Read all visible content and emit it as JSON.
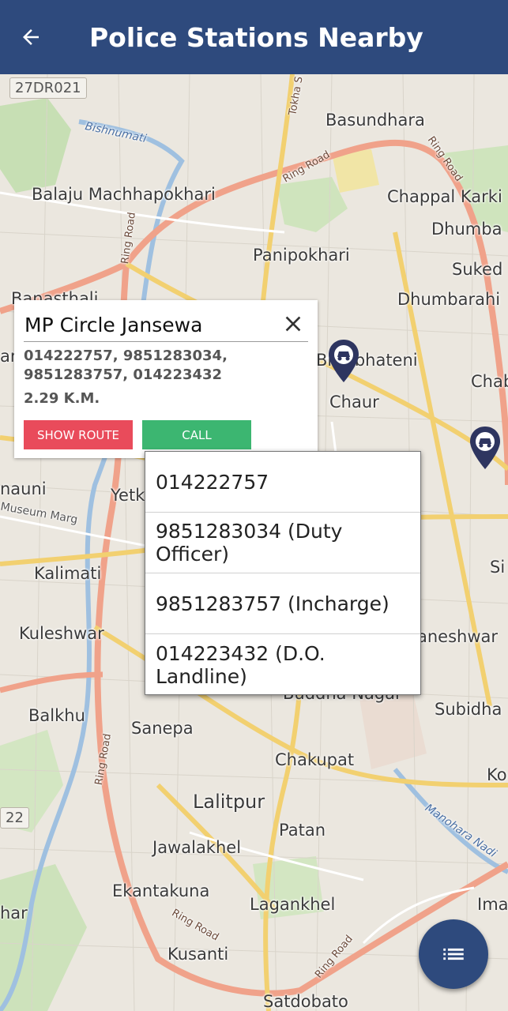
{
  "header": {
    "title": "Police Stations Nearby",
    "back_icon": "arrow-left-icon"
  },
  "map": {
    "labels": {
      "road_code": "27DR021",
      "road_code_2": "22",
      "basundhara": "Basundhara",
      "bishnumati": "Bishnumati",
      "tokha": "Tokha S",
      "balaju": "Balaju Machhapokhari",
      "chappal": "Chappal Karki",
      "dhumba": "Dhumba",
      "panipokhari": "Panipokhari",
      "suked": "Suked",
      "dhumbarahi": "Dhumbarahi",
      "banasthali": "Banasthali",
      "bhagwati": "Bhatbhateni",
      "chaur": "Chaur",
      "chab": "Chab",
      "nauni": "nauni",
      "yetk": "Yetk",
      "museum": "Museum Marg",
      "kalimati": "Kalimati",
      "kuleshwar": "Kuleshwar",
      "aneshwar": "aneshwar",
      "si": "Si",
      "balkhu": "Balkhu",
      "sanepa": "Sanepa",
      "buddha": "Buddha Nagar",
      "subidha": "Subidha",
      "chakupat": "Chakupat",
      "ko": "Ko",
      "lalitpur": "Lalitpur",
      "patan": "Patan",
      "manohara": "Manohara Nadi",
      "jawalakhel": "Jawalakhel",
      "ekantakuna": "Ekantakuna",
      "lagankhel": "Lagankhel",
      "imado": "Imado",
      "har": "har",
      "kusanti": "Kusanti",
      "satdobato": "Satdobato",
      "ring_road": "Ring Road",
      "an": "an"
    },
    "marker_icon": "police-station-marker-icon"
  },
  "station_card": {
    "name": "MP Circle Jansewa",
    "phones": "014222757, 9851283034, 9851283757, 014223432",
    "distance": "2.29 K.M.",
    "show_route_label": "SHOW ROUTE",
    "call_label": "CALL",
    "close_icon": "close-icon",
    "colors": {
      "show_route": "#e94b5b",
      "call": "#3cb671"
    }
  },
  "call_menu": {
    "items": [
      {
        "label": "014222757"
      },
      {
        "label": "9851283034 (Duty Officer)"
      },
      {
        "label": "9851283757 (Incharge)"
      },
      {
        "label": "014223432 (D.O. Landline)"
      }
    ]
  },
  "fab": {
    "icon": "list-icon"
  },
  "colors": {
    "primary": "#2e4a7d",
    "map_bg": "#e9e5dc"
  }
}
